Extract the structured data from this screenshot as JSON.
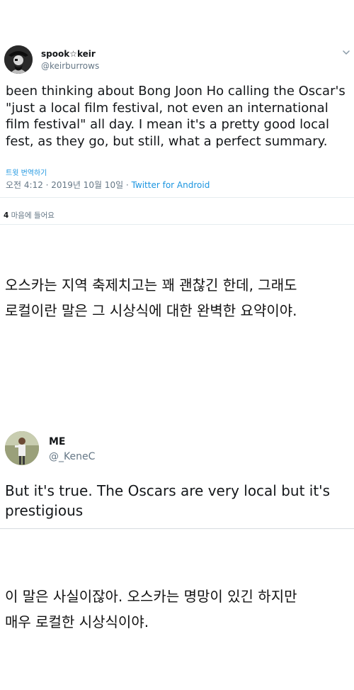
{
  "tweet1": {
    "display_name": "spook☆keir",
    "handle": "@keirburrows",
    "text": "been thinking about Bong Joon Ho calling the Oscar's \"just a local film festival, not even an international film festival\" all day. I mean it's a pretty good local fest, as they go, but still, what a perfect summary.",
    "translate_label": "트윗 번역하기",
    "timestamp": "오전 4:12 · 2019년 10월 10일 · ",
    "source": "Twitter for Android",
    "likes_count": "4",
    "likes_label": " 마음에 들어요",
    "avatar_icon": "pirate-avatar-icon",
    "menu_icon": "chevron-down-icon"
  },
  "caption1": {
    "line1": "오스카는 지역 축제치고는 꽤 괜찮긴 한데, 그래도",
    "line2": "로컬이란 말은 그 시상식에 대한 완벽한 요약이야."
  },
  "tweet2": {
    "display_name": "ME",
    "handle": "@_KeneC",
    "text": "But it's true. The Oscars are very local but it's prestigious",
    "avatar_icon": "person-photo-avatar-icon"
  },
  "caption2": {
    "line1": "이 말은 사실이잖아. 오스카는 명망이 있긴 하지만",
    "line2": "매우 로컬한 시상식이야."
  },
  "colors": {
    "text": "#14171a",
    "secondary": "#657786",
    "link": "#1b95e0",
    "divider": "#e6ecf0"
  }
}
